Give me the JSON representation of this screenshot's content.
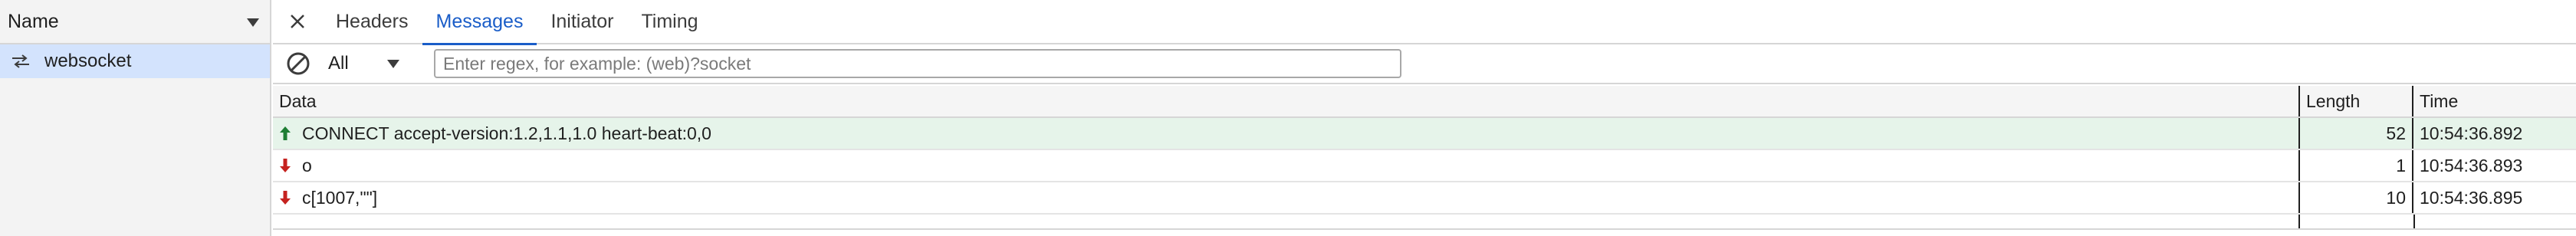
{
  "requests_panel": {
    "column_header": "Name",
    "items": [
      {
        "name": "websocket",
        "icon": "websocket-arrows-icon"
      }
    ]
  },
  "tabs": [
    {
      "label": "Headers"
    },
    {
      "label": "Messages"
    },
    {
      "label": "Initiator"
    },
    {
      "label": "Timing"
    }
  ],
  "active_tab": "Messages",
  "filter": {
    "type_selected": "All",
    "placeholder": "Enter regex, for example: (web)?socket",
    "value": ""
  },
  "messages_table": {
    "headers": {
      "data": "Data",
      "length": "Length",
      "time": "Time"
    },
    "rows": [
      {
        "direction": "sent",
        "data": "CONNECT accept-version:1.2,1.1,1.0 heart-beat:0,0",
        "length": "52",
        "time": "10:54:36.892"
      },
      {
        "direction": "received",
        "data": "o",
        "length": "1",
        "time": "10:54:36.893"
      },
      {
        "direction": "received",
        "data": "c[1007,\"\"]",
        "length": "10",
        "time": "10:54:36.895"
      }
    ]
  },
  "colors": {
    "accent": "#1a5dc8",
    "sent_row_bg": "#e6f4ea",
    "sent_arrow": "#1e7e34",
    "received_arrow": "#c5221f",
    "selected_request_bg": "#d3e3fd"
  }
}
